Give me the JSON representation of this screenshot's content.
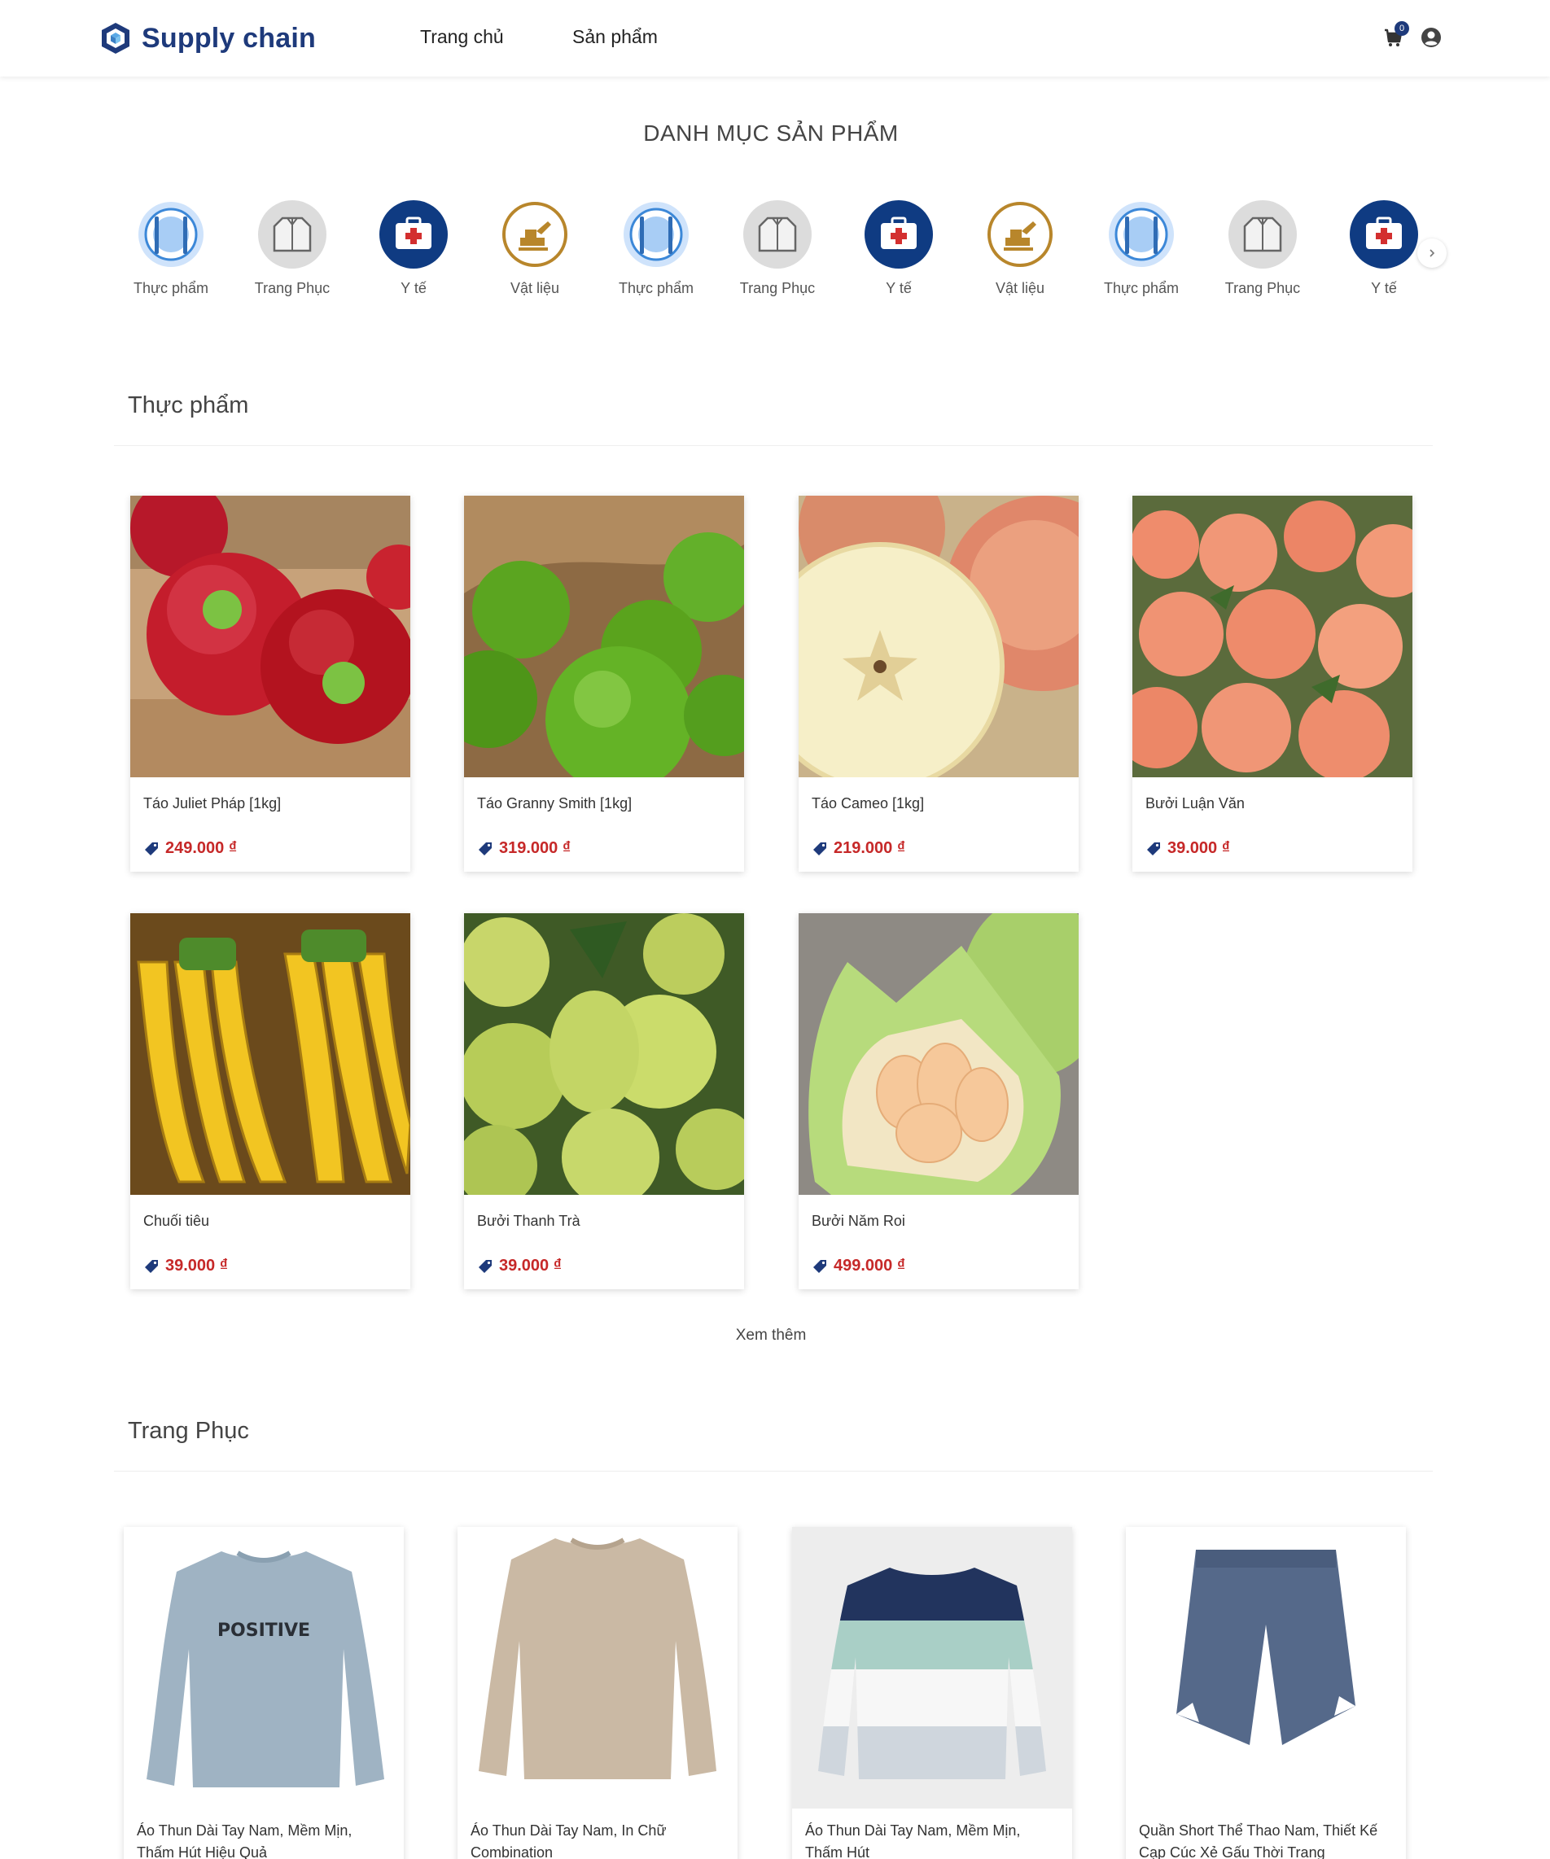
{
  "header": {
    "logo_text": "Supply chain",
    "nav": {
      "home": "Trang chủ",
      "products": "Sản phẩm"
    },
    "cart_count": "0"
  },
  "categories": {
    "title": "DANH MỤC SẢN PHẨM",
    "items": [
      {
        "label": "Thực phẩm",
        "icon": "food-icon"
      },
      {
        "label": "Trang Phục",
        "icon": "jacket-icon"
      },
      {
        "label": "Y tế",
        "icon": "medical-kit-icon"
      },
      {
        "label": "Vật liệu",
        "icon": "excavator-icon"
      },
      {
        "label": "Thực phẩm",
        "icon": "food-icon"
      },
      {
        "label": "Trang Phục",
        "icon": "jacket-icon"
      },
      {
        "label": "Y tế",
        "icon": "medical-kit-icon"
      },
      {
        "label": "Vật liệu",
        "icon": "excavator-icon"
      },
      {
        "label": "Thực phẩm",
        "icon": "food-icon"
      },
      {
        "label": "Trang Phục",
        "icon": "jacket-icon"
      },
      {
        "label": "Y tế",
        "icon": "medical-kit-icon"
      }
    ]
  },
  "food_section": {
    "title": "Thực phẩm",
    "products": [
      {
        "name": "Táo Juliet Pháp [1kg]",
        "price": "249.000 ₫",
        "image": "red-apples"
      },
      {
        "name": "Táo Granny Smith [1kg]",
        "price": "319.000 ₫",
        "image": "green-apples"
      },
      {
        "name": "Táo Cameo [1kg]",
        "price": "219.000 ₫",
        "image": "cut-apple"
      },
      {
        "name": "Bưởi Luận Văn",
        "price": "39.000 ₫",
        "image": "pink-pomelos"
      },
      {
        "name": "Chuối tiêu",
        "price": "39.000 ₫",
        "image": "bananas"
      },
      {
        "name": "Bưởi Thanh Trà",
        "price": "39.000 ₫",
        "image": "green-pomelos"
      },
      {
        "name": "Bưởi Năm Roi",
        "price": "499.000 ₫",
        "image": "peeled-pomelo"
      }
    ],
    "more": "Xem thêm"
  },
  "clothing_section": {
    "title": "Trang Phục",
    "products": [
      {
        "name": "Áo Thun Dài Tay Nam, Mềm Mịn, Thấm Hút Hiệu Quả",
        "print": "POSITIVE",
        "image": "blue-longsleeve-shirt"
      },
      {
        "name": "Áo Thun Dài Tay Nam, In Chữ Combination",
        "image": "beige-longsleeve-shirt"
      },
      {
        "name": "Áo Thun Dài Tay Nam, Mềm Mịn, Thấm Hút",
        "image": "striped-longsleeve-shirt"
      },
      {
        "name": "Quần Short Thể Thao Nam, Thiết Kế Cạp Cúc Xẻ Gấu Thời Trang",
        "image": "navy-shorts"
      }
    ]
  },
  "colors": {
    "brand": "#1e3a7b",
    "price": "#c62828"
  }
}
